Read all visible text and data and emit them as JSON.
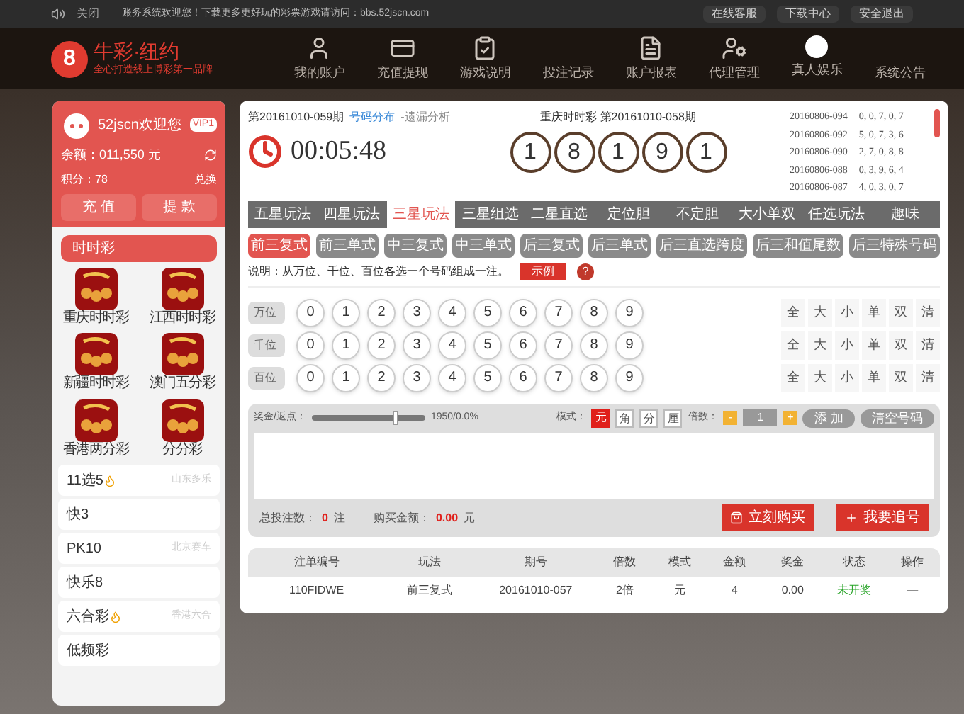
{
  "top_bar": {
    "sound_label": "关闭",
    "notice": "账务系统欢迎您！下载更多更好玩的彩票游戏请访问：bbs.52jscn.com",
    "buttons": [
      "在线客服",
      "下载中心",
      "安全退出"
    ]
  },
  "header": {
    "logo_mark": "8",
    "brand": "牛彩·纽约",
    "slogan": "全心打造线上博彩第一品牌",
    "nav": [
      {
        "label": "我的账户",
        "kind": "user"
      },
      {
        "label": "充值提现",
        "kind": "card"
      },
      {
        "label": "游戏说明",
        "kind": "clipboard"
      },
      {
        "label": "投注记录",
        "kind": "none"
      },
      {
        "label": "账户报表",
        "kind": "report"
      },
      {
        "label": "代理管理",
        "kind": "agent"
      },
      {
        "label": "真人娱乐",
        "kind": "eight"
      },
      {
        "label": "系统公告",
        "kind": "none"
      }
    ]
  },
  "sidebar": {
    "user": {
      "name": "52jscn欢迎您",
      "vip": "VIP1",
      "balance": "余额：011,550 元",
      "points": "积分：78",
      "exchange": "兑换",
      "buttons": [
        "充 值",
        "提 款"
      ]
    },
    "section": "时时彩",
    "games": [
      "重庆时时彩",
      "江西时时彩",
      "新疆时时彩",
      "澳门五分彩",
      "香港两分彩",
      "分分彩"
    ],
    "items": [
      {
        "label": "11选5",
        "hot": true,
        "note": "山东多乐"
      },
      {
        "label": "快3",
        "hot": false
      },
      {
        "label": "PK10",
        "hot": false,
        "note": "北京赛车"
      },
      {
        "label": "快乐8",
        "hot": false
      },
      {
        "label": "六合彩",
        "hot": true,
        "note": "香港六合"
      },
      {
        "label": "低频彩",
        "hot": false
      }
    ]
  },
  "main": {
    "period": "第20161010-059期",
    "links": [
      "号码分布",
      "-遗漏分析"
    ],
    "countdown": "00:05:48",
    "last_draw": "重庆时时彩 第20161010-058期",
    "balls": [
      "1",
      "8",
      "1",
      "9",
      "1"
    ],
    "history": [
      {
        "issue": "20160806-094",
        "numbers": "0, 0, 7, 0, 7"
      },
      {
        "issue": "20160806-092",
        "numbers": "5, 0, 7, 3, 6"
      },
      {
        "issue": "20160806-090",
        "numbers": "2, 7, 0, 8, 8"
      },
      {
        "issue": "20160806-088",
        "numbers": "0, 3, 9, 6, 4"
      },
      {
        "issue": "20160806-087",
        "numbers": "4, 0, 3, 0, 7"
      }
    ],
    "tabs": [
      {
        "label": "五星玩法",
        "selected": false
      },
      {
        "label": "四星玩法",
        "selected": false
      },
      {
        "label": "三星玩法",
        "selected": true
      },
      {
        "label": "三星组选",
        "selected": false
      },
      {
        "label": "二星直选",
        "selected": false
      },
      {
        "label": "定位胆",
        "selected": false
      },
      {
        "label": "不定胆",
        "selected": false
      },
      {
        "label": "大小单双",
        "selected": false
      },
      {
        "label": "任选玩法",
        "selected": false
      },
      {
        "label": "趣味",
        "selected": false
      }
    ],
    "subtabs": [
      {
        "label": "前三复式",
        "selected": true
      },
      {
        "label": "前三单式",
        "selected": false
      },
      {
        "label": "中三复式",
        "selected": false
      },
      {
        "label": "中三单式",
        "selected": false
      },
      {
        "label": "后三复式",
        "selected": false
      },
      {
        "label": "后三单式",
        "selected": false
      },
      {
        "label": "后三直选跨度",
        "selected": false
      },
      {
        "label": "后三和值尾数",
        "selected": false
      },
      {
        "label": "后三特殊号码",
        "selected": false
      }
    ],
    "description": "说明：从万位、千位、百位各选一个号码组成一注。",
    "example_button": "示例",
    "help": "?",
    "rows": [
      {
        "position": "万位",
        "digits": [
          "0",
          "1",
          "2",
          "3",
          "4",
          "5",
          "6",
          "7",
          "8",
          "9"
        ],
        "quick": [
          "全",
          "大",
          "小",
          "单",
          "双",
          "清"
        ]
      },
      {
        "position": "千位",
        "digits": [
          "0",
          "1",
          "2",
          "3",
          "4",
          "5",
          "6",
          "7",
          "8",
          "9"
        ],
        "quick": [
          "全",
          "大",
          "小",
          "单",
          "双",
          "清"
        ]
      },
      {
        "position": "百位",
        "digits": [
          "0",
          "1",
          "2",
          "3",
          "4",
          "5",
          "6",
          "7",
          "8",
          "9"
        ],
        "quick": [
          "全",
          "大",
          "小",
          "单",
          "双",
          "清"
        ]
      }
    ],
    "bet": {
      "rebate_label": "奖金/返点：",
      "rebate": {
        "level": 0.75
      },
      "rebate_reading": "1950/0.0%",
      "mode_label": "模式：",
      "modes": [
        {
          "label": "元",
          "selected": true
        },
        {
          "label": "角",
          "selected": false
        },
        {
          "label": "分",
          "selected": false
        },
        {
          "label": "厘",
          "selected": false
        }
      ],
      "multiple_label": "倍数：",
      "minus": "-",
      "multiple": "1",
      "plus": "+",
      "add": "添 加",
      "clear": "清空号码",
      "total_label": "总投注数：",
      "total": "0",
      "total_unit": "注",
      "amount_label": "购买金额：",
      "amount": "0.00",
      "amount_unit": "元",
      "buy": "立刻购买",
      "chase": "我要追号"
    },
    "table": {
      "columns": [
        "注单编号",
        "玩法",
        "期号",
        "倍数",
        "模式",
        "金额",
        "奖金",
        "状态",
        "操作"
      ],
      "rows": [
        [
          "110FIDWE",
          "前三复式",
          "20161010-057",
          "2倍",
          "元",
          "4",
          "0.00",
          "未开奖",
          "—"
        ]
      ]
    }
  }
}
